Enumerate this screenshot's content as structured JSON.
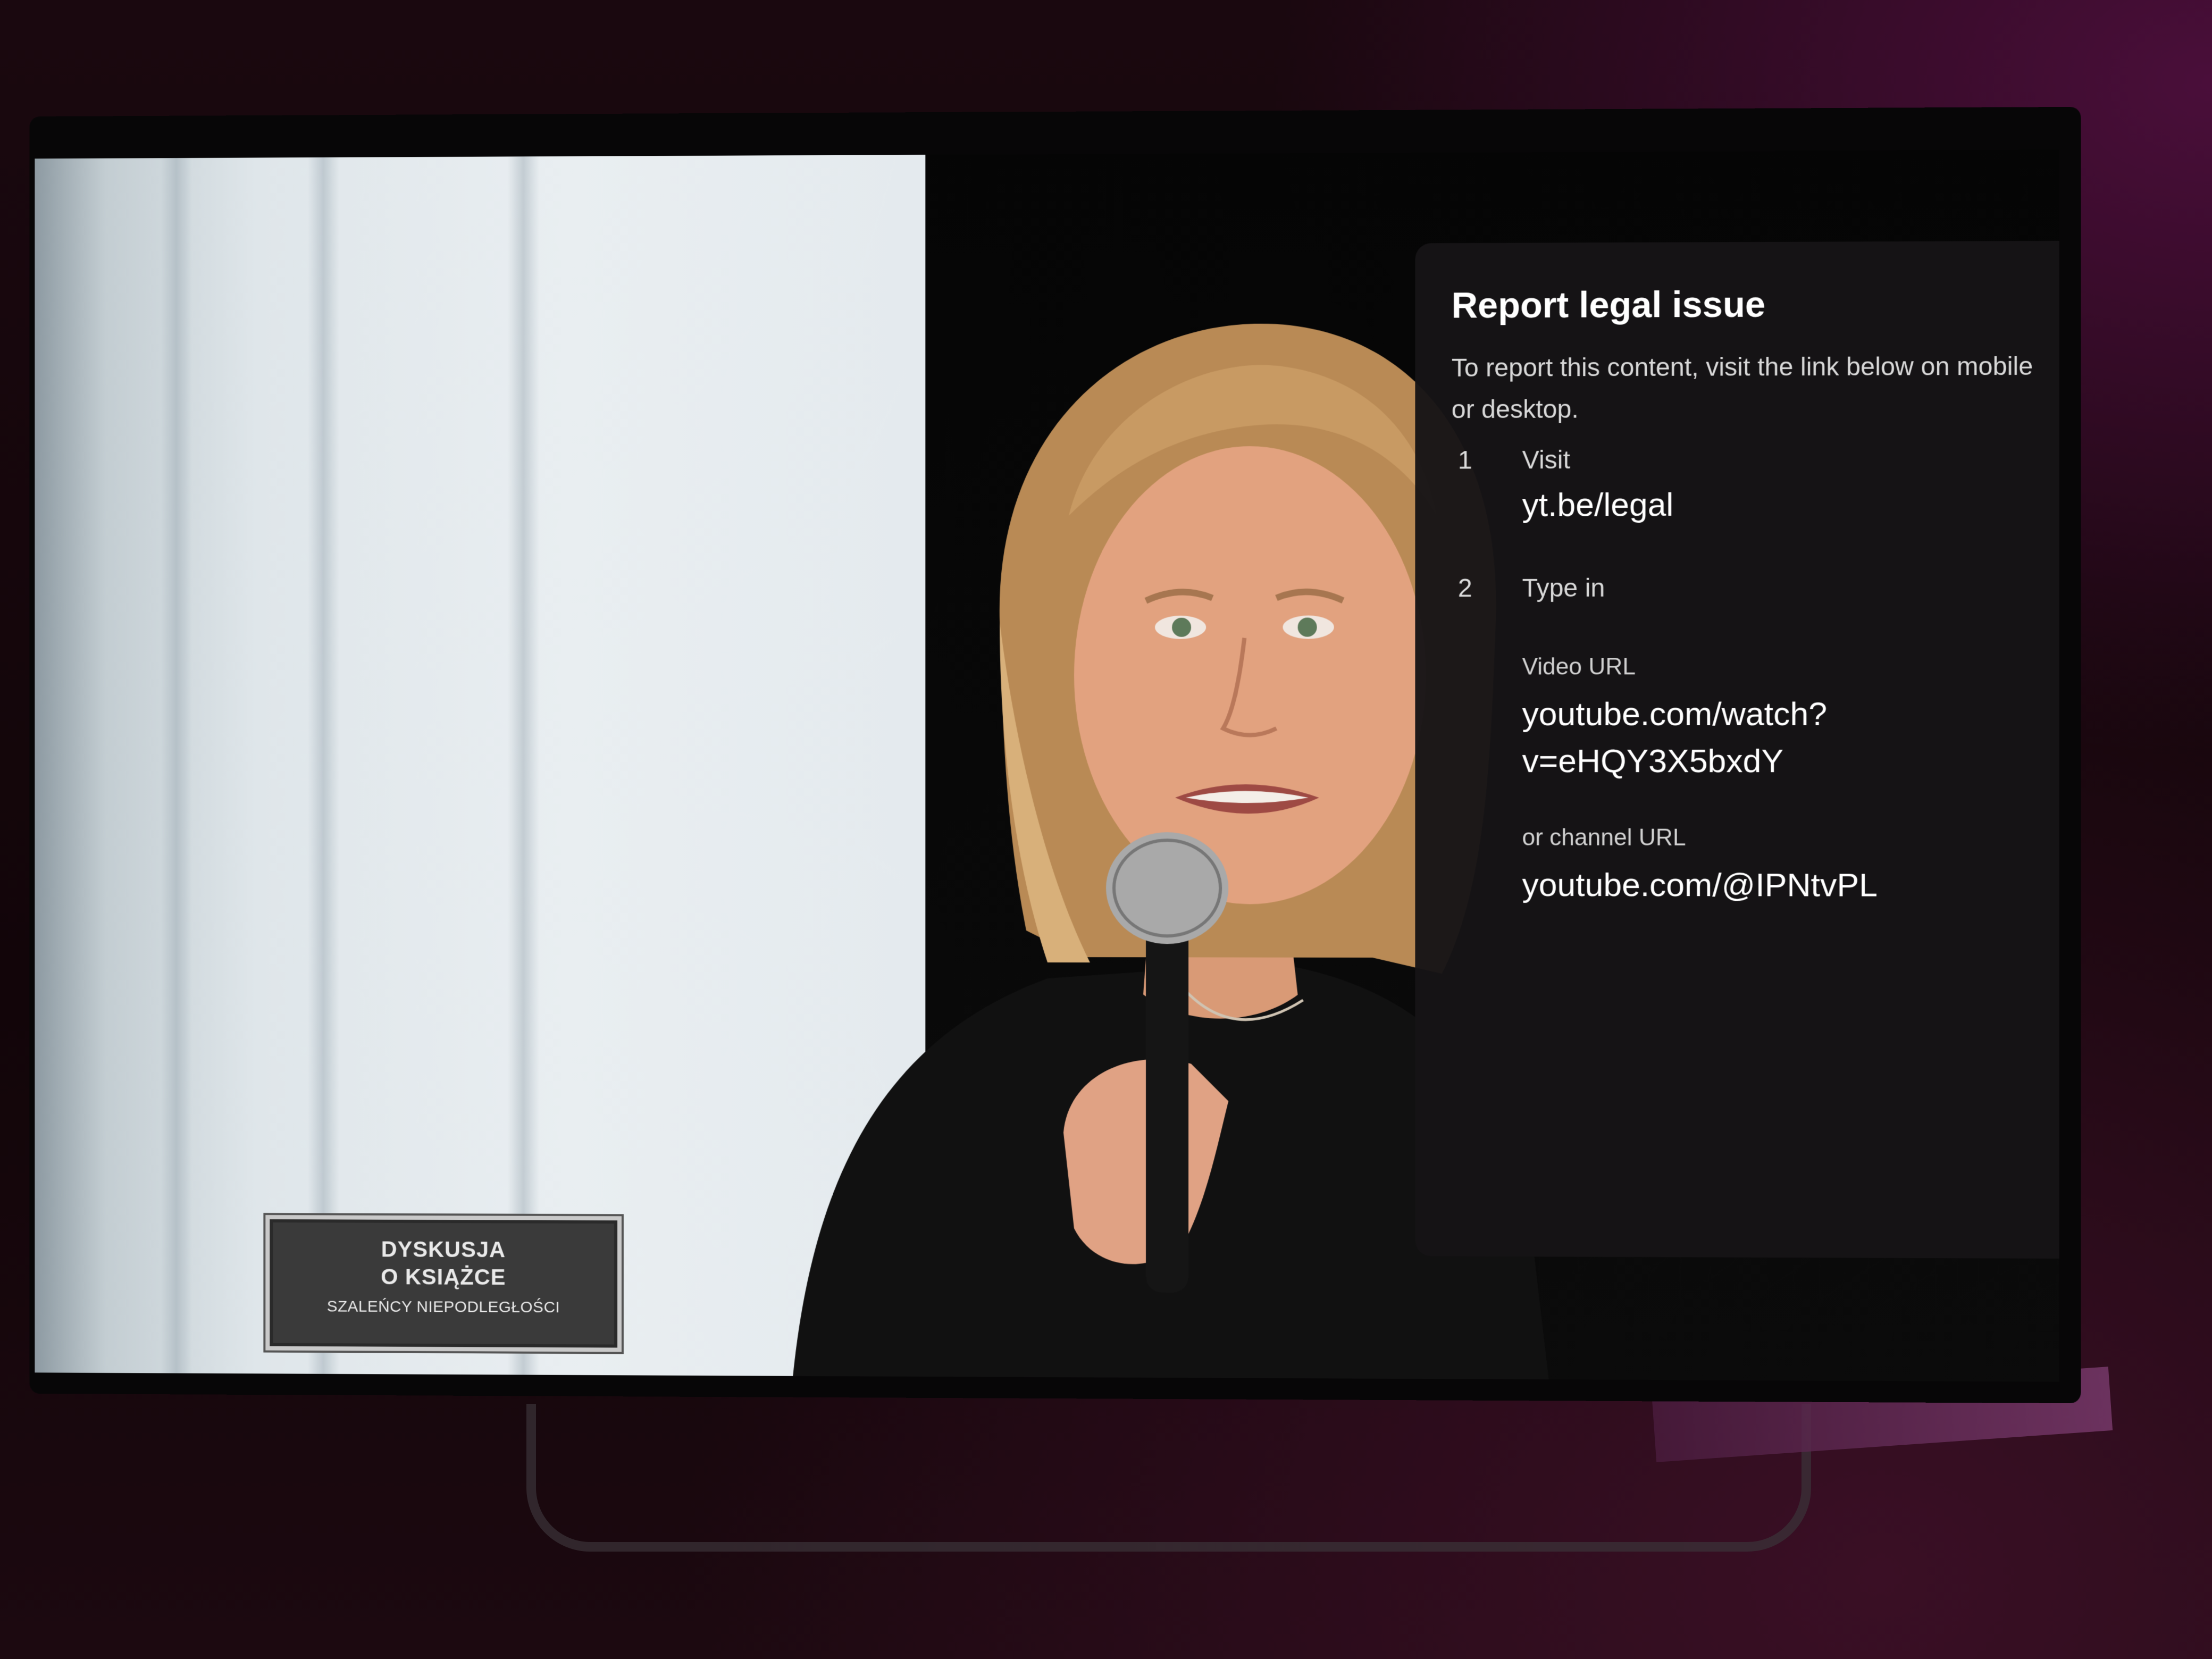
{
  "video": {
    "caption": {
      "title_line1": "DYSKUSJA",
      "title_line2": "O KSIĄŻCE",
      "subtitle": "SZALEŃCY NIEPODLEGŁOŚCI"
    }
  },
  "report_panel": {
    "title": "Report legal issue",
    "description": "To report this content, visit the link below on mobile or desktop.",
    "steps": [
      {
        "number": "1",
        "label": "Visit",
        "link": "yt.be/legal"
      },
      {
        "number": "2",
        "label": "Type in",
        "video_url_label": "Video URL",
        "video_url_line1": "youtube.com/watch?",
        "video_url_line2": "v=eHQY3X5bxdY",
        "channel_url_label": "or channel URL",
        "channel_url": "youtube.com/@IPNtvPL"
      }
    ]
  }
}
